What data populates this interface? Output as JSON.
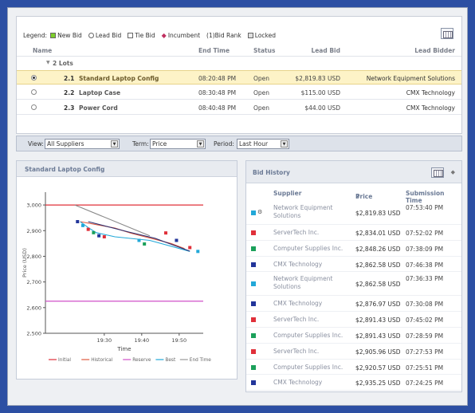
{
  "legend": {
    "label": "Legend:",
    "items": [
      {
        "text": "New Bid",
        "color": "#7dcf2a"
      },
      {
        "text": "Lead Bid",
        "color": "#ffffff"
      },
      {
        "text": "Tie Bid",
        "color": "#ffffff"
      },
      {
        "text": "Incumbent",
        "color": "#c03060"
      },
      {
        "text": "(1)Bid Rank",
        "color": null
      },
      {
        "text": "Locked",
        "color": "#e0e0e0"
      }
    ]
  },
  "lots_table": {
    "headers": {
      "name": "Name",
      "end_time": "End Time",
      "status": "Status",
      "lead_bid": "Lead Bid",
      "lead_bidder": "Lead Bidder"
    },
    "group": "2 Lots",
    "rows": [
      {
        "num": "2.1",
        "name": "Standard Laptop Config",
        "end_time": "08:20:48 PM",
        "status": "Open",
        "lead_bid": "$2,819.83 USD",
        "lead_bidder": "Network Equipment Solutions",
        "selected": true
      },
      {
        "num": "2.2",
        "name": "Laptop Case",
        "end_time": "08:30:48 PM",
        "status": "Open",
        "lead_bid": "$115.00 USD",
        "lead_bidder": "CMX Technology",
        "selected": false
      },
      {
        "num": "2.3",
        "name": "Power Cord",
        "end_time": "08:40:48 PM",
        "status": "Open",
        "lead_bid": "$44.00 USD",
        "lead_bidder": "CMX Technology",
        "selected": false
      }
    ]
  },
  "toolbar": {
    "view_label": "View:",
    "view_value": "All Suppliers",
    "term_label": "Term:",
    "term_value": "Price",
    "period_label": "Period:",
    "period_value": "Last Hour"
  },
  "chart_panel_title": "Standard Laptop Config",
  "chart_data": {
    "type": "line",
    "ylabel": "Price (USD)",
    "xlabel": "Time",
    "ylim": [
      2500,
      3050
    ],
    "yticks": [
      "3,000",
      "2,900",
      "2,800",
      "2,700",
      "2,600",
      "2,500"
    ],
    "xticks": [
      "19:30",
      "19:40",
      "19:50"
    ],
    "xrange_minutes": [
      1,
      60
    ],
    "xtick_minutes": [
      23,
      37,
      51
    ],
    "reference_lines": [
      {
        "name": "Initial",
        "value": 3000,
        "color": "#e0303a"
      },
      {
        "name": "Reserve",
        "value": 2625,
        "color": "#d050c8"
      }
    ],
    "series": [
      {
        "name": "Historical",
        "color": "#e05a40",
        "points": [
          [
            14,
            2935
          ],
          [
            27,
            2910
          ],
          [
            33,
            2890
          ],
          [
            48,
            2850
          ],
          [
            53,
            2830
          ]
        ]
      },
      {
        "name": "Best",
        "color": "#22a8d8",
        "points": [
          [
            14,
            2935
          ],
          [
            17,
            2912
          ],
          [
            20,
            2892
          ],
          [
            27,
            2876
          ],
          [
            40,
            2862
          ],
          [
            55,
            2819
          ]
        ]
      },
      {
        "name": "Historical",
        "color": "#2d2f70",
        "points": [
          [
            17,
            2935
          ],
          [
            32,
            2895
          ],
          [
            42,
            2870
          ],
          [
            55,
            2820
          ]
        ]
      },
      {
        "name": "Historical",
        "color": "#888888",
        "points": [
          [
            12,
            3000
          ],
          [
            40,
            2880
          ]
        ]
      }
    ],
    "markers": [
      {
        "x": 13,
        "y": 2935,
        "color": "#22359a"
      },
      {
        "x": 15,
        "y": 2920,
        "color": "#22a8d8"
      },
      {
        "x": 17,
        "y": 2905,
        "color": "#e0303a"
      },
      {
        "x": 19,
        "y": 2892,
        "color": "#1ba05a"
      },
      {
        "x": 21,
        "y": 2880,
        "color": "#22359a"
      },
      {
        "x": 23,
        "y": 2876,
        "color": "#e0303a"
      },
      {
        "x": 36,
        "y": 2862,
        "color": "#22a8d8"
      },
      {
        "x": 38,
        "y": 2848,
        "color": "#1ba05a"
      },
      {
        "x": 46,
        "y": 2891,
        "color": "#e0303a"
      },
      {
        "x": 50,
        "y": 2862,
        "color": "#22359a"
      },
      {
        "x": 55,
        "y": 2834,
        "color": "#e0303a"
      },
      {
        "x": 58,
        "y": 2819,
        "color": "#22a8d8"
      }
    ],
    "legend": [
      "Initial",
      "Historical",
      "Reserve",
      "Best",
      "End Time"
    ],
    "legend_colors": [
      "#e0303a",
      "#e05a40",
      "#d050c8",
      "#22a8d8",
      "#999999"
    ]
  },
  "bid_history": {
    "title": "Bid History",
    "headers": {
      "supplier": "Supplier",
      "price": "Price",
      "submission": "Submission Time"
    },
    "rows": [
      {
        "supplier": "Network Equipment Solutions",
        "price": "$2,819.83 USD",
        "time": "07:53:40 PM",
        "color": "#22a8d8",
        "tall": true,
        "gear": true
      },
      {
        "supplier": "ServerTech Inc.",
        "price": "$2,834.01 USD",
        "time": "07:52:02 PM",
        "color": "#e0303a",
        "tall": false,
        "gear": false
      },
      {
        "supplier": "Computer Supplies Inc.",
        "price": "$2,848.26 USD",
        "time": "07:38:09 PM",
        "color": "#1ba05a",
        "tall": false,
        "gear": false
      },
      {
        "supplier": "CMX Technology",
        "price": "$2,862.58 USD",
        "time": "07:46:38 PM",
        "color": "#22359a",
        "tall": false,
        "gear": false
      },
      {
        "supplier": "Network Equipment Solutions",
        "price": "$2,862.58 USD",
        "time": "07:36:33 PM",
        "color": "#22a8d8",
        "tall": true,
        "gear": false
      },
      {
        "supplier": "CMX Technology",
        "price": "$2,876.97 USD",
        "time": "07:30:08 PM",
        "color": "#22359a",
        "tall": false,
        "gear": false
      },
      {
        "supplier": "ServerTech Inc.",
        "price": "$2,891.43 USD",
        "time": "07:45:02 PM",
        "color": "#e0303a",
        "tall": false,
        "gear": false
      },
      {
        "supplier": "Computer Supplies Inc.",
        "price": "$2,891.43 USD",
        "time": "07:28:59 PM",
        "color": "#1ba05a",
        "tall": false,
        "gear": false
      },
      {
        "supplier": "ServerTech Inc.",
        "price": "$2,905.96 USD",
        "time": "07:27:53 PM",
        "color": "#e0303a",
        "tall": false,
        "gear": false
      },
      {
        "supplier": "Computer Supplies Inc.",
        "price": "$2,920.57 USD",
        "time": "07:25:51 PM",
        "color": "#1ba05a",
        "tall": false,
        "gear": false
      },
      {
        "supplier": "CMX Technology",
        "price": "$2,935.25 USD",
        "time": "07:24:25 PM",
        "color": "#22359a",
        "tall": false,
        "gear": false
      }
    ]
  }
}
